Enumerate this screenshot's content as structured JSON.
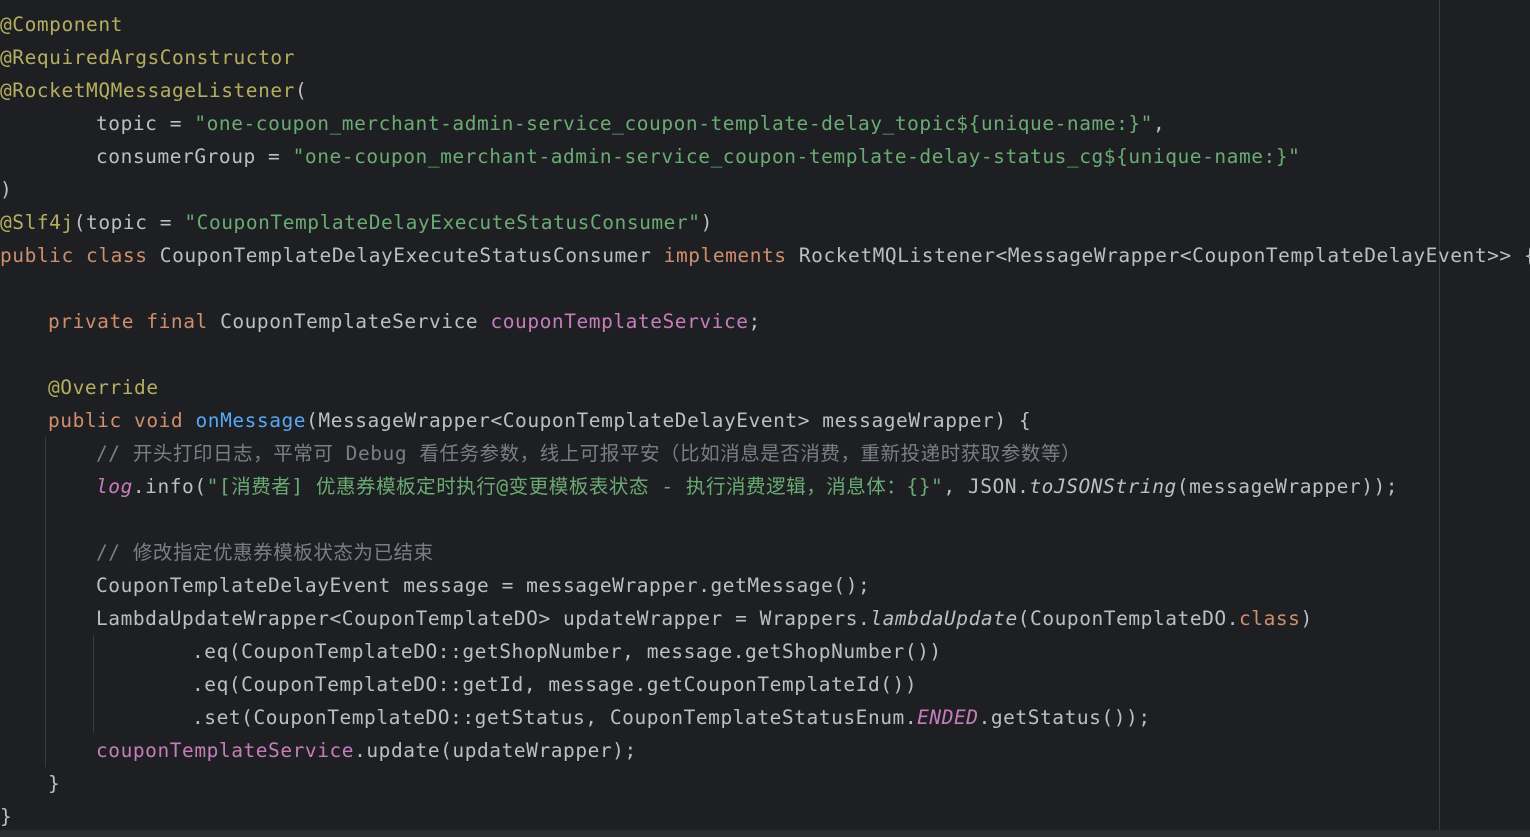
{
  "code_lines": [
    "@Component",
    "@RequiredArgsConstructor",
    "@RocketMQMessageListener(",
    "topic = \"one-coupon_merchant-admin-service_coupon-template-delay_topic${unique-name:}\",",
    "consumerGroup = \"one-coupon_merchant-admin-service_coupon-template-delay-status_cg${unique-name:}\"",
    ")",
    "@Slf4j(topic = \"CouponTemplateDelayExecuteStatusConsumer\")",
    "public class CouponTemplateDelayExecuteStatusConsumer implements RocketMQListener<MessageWrapper<CouponTemplateDelayEvent>> {",
    "",
    "private final CouponTemplateService couponTemplateService;",
    "",
    "@Override",
    "public void onMessage(MessageWrapper<CouponTemplateDelayEvent> messageWrapper) {",
    "// 开头打印日志，平常可 Debug 看任务参数，线上可报平安（比如消息是否消费，重新投递时获取参数等）",
    "log.info(\"[消费者] 优惠券模板定时执行@变更模板表状态 - 执行消费逻辑，消息体：{}\", JSON.toJSONString(messageWrapper));",
    "",
    "// 修改指定优惠券模板状态为已结束",
    "CouponTemplateDelayEvent message = messageWrapper.getMessage();",
    "LambdaUpdateWrapper<CouponTemplateDO> updateWrapper = Wrappers.lambdaUpdate(CouponTemplateDO.class)",
    ".eq(CouponTemplateDO::getShopNumber, message.getShopNumber())",
    ".eq(CouponTemplateDO::getId, message.getCouponTemplateId())",
    ".set(CouponTemplateDO::getStatus, CouponTemplateStatusEnum.ENDED.getStatus());",
    "couponTemplateService.update(updateWrapper);",
    "}",
    "}"
  ],
  "t": {
    "l1": "@Component",
    "l2": "@RequiredArgsConstructor",
    "l3a": "@RocketMQMessageListener",
    "l3b": "(",
    "l4a": "topic = ",
    "l4b": "\"one-coupon_merchant-admin-service_coupon-template-delay_topic${unique-name:}\"",
    "l4c": ",",
    "l5a": "consumerGroup = ",
    "l5b": "\"one-coupon_merchant-admin-service_coupon-template-delay-status_cg${unique-name:}\"",
    "l6": ")",
    "l7a": "@Slf4j",
    "l7b": "(topic = ",
    "l7c": "\"CouponTemplateDelayExecuteStatusConsumer\"",
    "l7d": ")",
    "l8a": "public class ",
    "l8b": "CouponTemplateDelayExecuteStatusConsumer ",
    "l8c": "implements ",
    "l8d": "RocketMQListener<MessageWrapper<CouponTemplateDelayEvent>> {",
    "l10a": "private final ",
    "l10b": "CouponTemplateService ",
    "l10c": "couponTemplateService",
    "l10d": ";",
    "l12": "@Override",
    "l13a": "public void ",
    "l13b": "onMessage",
    "l13c": "(MessageWrapper<CouponTemplateDelayEvent> messageWrapper) {",
    "l14": "// 开头打印日志，平常可 Debug 看任务参数，线上可报平安（比如消息是否消费，重新投递时获取参数等）",
    "l15a": "log",
    "l15b": ".info(",
    "l15c": "\"[消费者] 优惠券模板定时执行@变更模板表状态 - 执行消费逻辑，消息体：{}\"",
    "l15d": ", JSON.",
    "l15e": "toJSONString",
    "l15f": "(messageWrapper));",
    "l17": "// 修改指定优惠券模板状态为已结束",
    "l18": "CouponTemplateDelayEvent message = messageWrapper.getMessage();",
    "l19a": "LambdaUpdateWrapper<CouponTemplateDO> updateWrapper = Wrappers.",
    "l19b": "lambdaUpdate",
    "l19c": "(CouponTemplateDO.",
    "l19d": "class",
    "l19e": ")",
    "l20": ".eq(CouponTemplateDO::getShopNumber, message.getShopNumber())",
    "l21": ".eq(CouponTemplateDO::getId, message.getCouponTemplateId())",
    "l22a": ".set(CouponTemplateDO::getStatus, CouponTemplateStatusEnum.",
    "l22b": "ENDED",
    "l22c": ".getStatus());",
    "l23a": "couponTemplateService",
    "l23b": ".update(updateWrapper);",
    "l24": "}",
    "l25": "}"
  },
  "colors": {
    "background": "#1e1f22",
    "annotation": "#b3ae60",
    "keyword": "#cf8e6d",
    "string": "#6aab73",
    "field": "#c77dbb",
    "method_declaration": "#56a8f5",
    "comment": "#7a7e85",
    "default_text": "#bcbec4"
  }
}
